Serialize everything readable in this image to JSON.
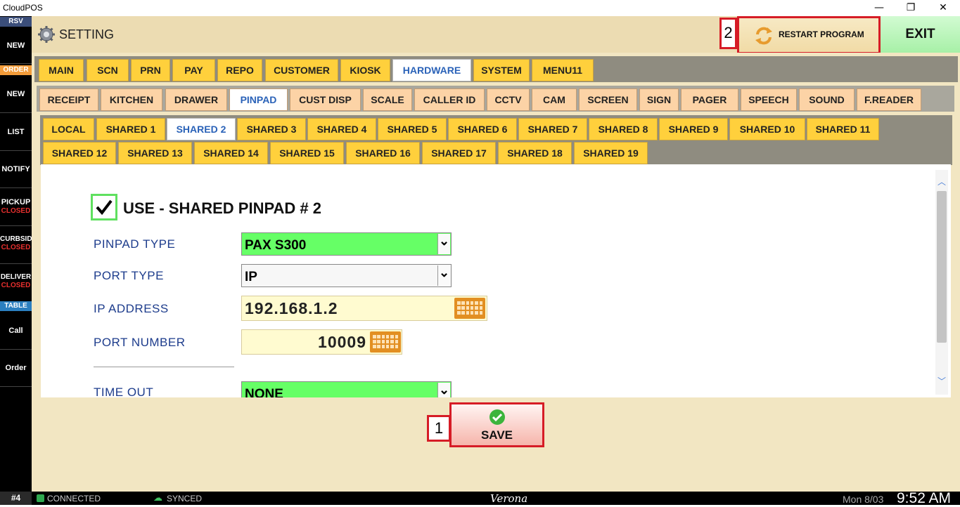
{
  "window": {
    "title": "CloudPOS",
    "controls": [
      "—",
      "❐",
      "✕"
    ]
  },
  "sidebar": {
    "rsv_label": "RSV",
    "order_label": "ORDER",
    "table_label": "TABLE",
    "items": [
      {
        "label": "NEW",
        "status": ""
      },
      {
        "label": "NEW",
        "status": ""
      },
      {
        "label": "LIST",
        "status": ""
      },
      {
        "label": "NOTIFY",
        "status": ""
      },
      {
        "label": "PICKUP",
        "status": "CLOSED"
      },
      {
        "label": "CURBSID",
        "status": "CLOSED"
      },
      {
        "label": "DELIVER",
        "status": "CLOSED"
      },
      {
        "label": "Call",
        "status": ""
      },
      {
        "label": "Order",
        "status": ""
      }
    ]
  },
  "header": {
    "title": "SETTING",
    "restart_label": "RESTART PROGRAM",
    "exit_label": "EXIT",
    "restart_marker": "2"
  },
  "tabs": {
    "main": [
      "MAIN",
      "SCN",
      "PRN",
      "PAY",
      "REPO",
      "CUSTOMER",
      "KIOSK",
      "HARDWARE",
      "SYSTEM",
      "MENU11"
    ],
    "main_selected": "HARDWARE",
    "hardware": [
      "RECEIPT",
      "KITCHEN",
      "DRAWER",
      "PINPAD",
      "CUST DISP",
      "SCALE",
      "CALLER ID",
      "CCTV",
      "CAM",
      "SCREEN",
      "SIGN",
      "PAGER",
      "SPEECH",
      "SOUND",
      "F.READER"
    ],
    "hardware_selected": "PINPAD",
    "pinpad_row1": [
      "LOCAL",
      "SHARED 1",
      "SHARED 2",
      "SHARED 3",
      "SHARED 4",
      "SHARED 5",
      "SHARED 6",
      "SHARED 7",
      "SHARED 8",
      "SHARED 9",
      "SHARED 10",
      "SHARED 11"
    ],
    "pinpad_row2": [
      "SHARED 12",
      "SHARED 13",
      "SHARED 14",
      "SHARED 15",
      "SHARED 16",
      "SHARED 17",
      "SHARED 18",
      "SHARED 19"
    ],
    "pinpad_selected": "SHARED 2"
  },
  "form": {
    "use_checkbox_label": "USE - SHARED PINPAD # 2",
    "use_checked": true,
    "pinpad_type_label": "PINPAD TYPE",
    "pinpad_type_value": "PAX S300",
    "port_type_label": "PORT TYPE",
    "port_type_value": "IP",
    "ip_label": "IP ADDRESS",
    "ip_value": "192.168.1.2",
    "port_label": "PORT NUMBER",
    "port_value": "10009",
    "timeout_label": "TIME OUT",
    "timeout_value": "NONE"
  },
  "save": {
    "label": "SAVE",
    "marker": "1"
  },
  "status": {
    "terminal": "#4",
    "connected": "CONNECTED",
    "synced": "SYNCED",
    "location": "Verona",
    "date": "Mon 8/03",
    "time": "9:52 AM"
  },
  "colors": {
    "accent_green": "#66ff66",
    "tab_yellow": "#ffd03c",
    "tab_orange": "#fcd3a6",
    "highlight_red": "#d61c26"
  }
}
